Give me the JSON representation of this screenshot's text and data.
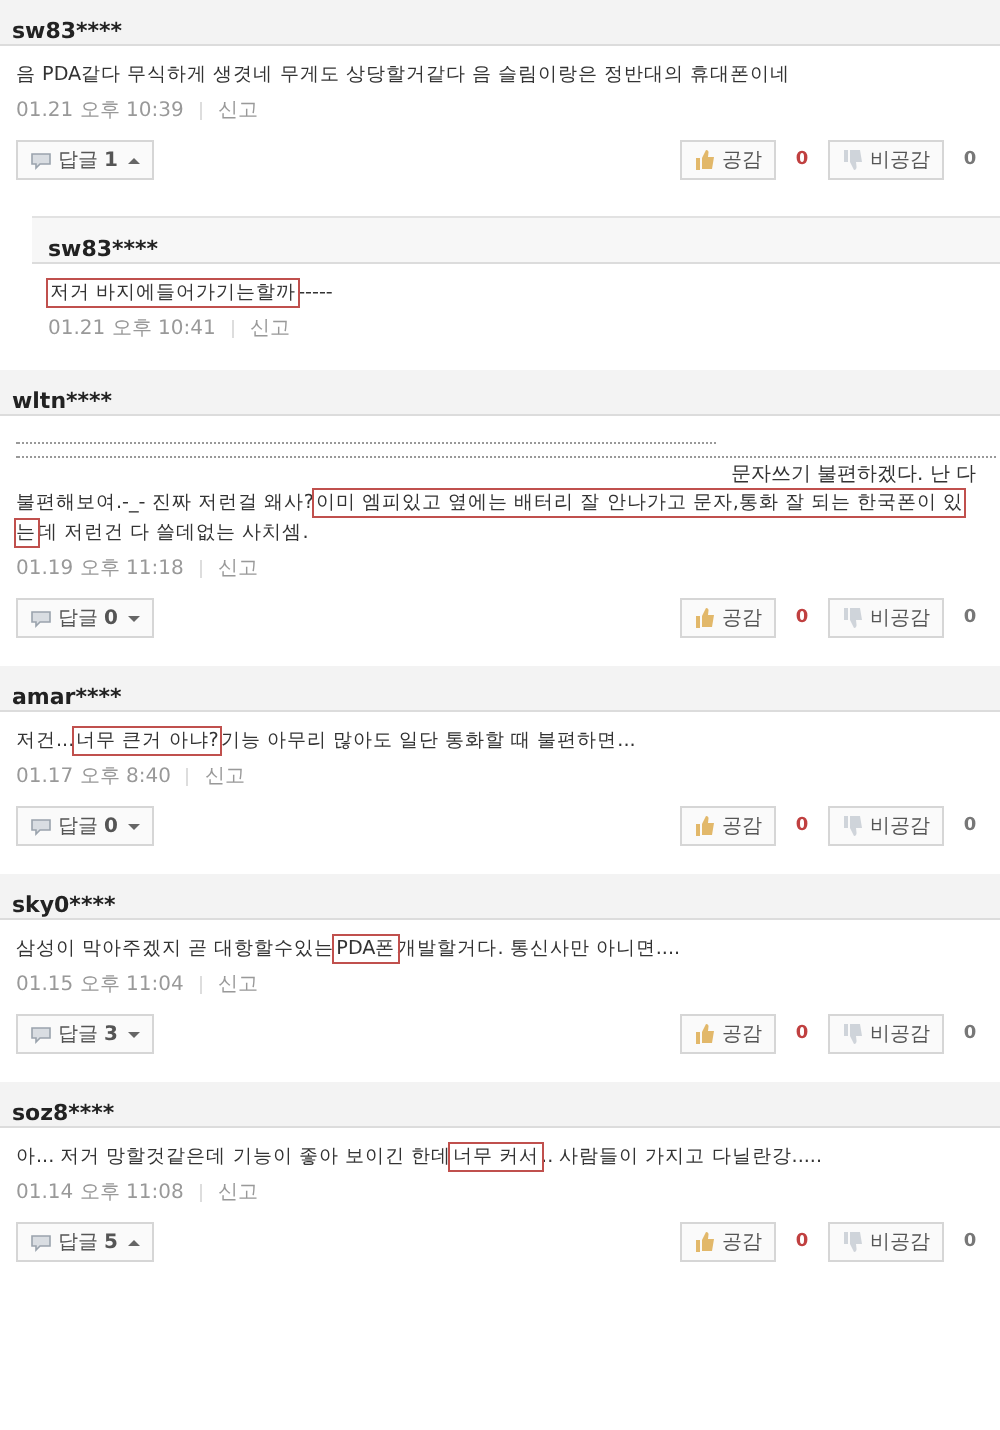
{
  "comments": [
    {
      "kind": "comment",
      "user": "sw83****",
      "segments": [
        {
          "text": "음 PDA같다 무식하게 생겻네 무게도 상당할거같다 음 슬림이랑은 정반대의 휴대폰이네",
          "highlight": false
        }
      ],
      "time": "01.21 오후 10:39",
      "report": "신고",
      "reply_label": "답글",
      "reply_count": "1",
      "expanded": true,
      "like": "공감",
      "like_count": "0",
      "dislike": "비공감",
      "dislike_count": "0"
    },
    {
      "kind": "reply",
      "user": "sw83****",
      "segments": [
        {
          "text": "저거 바지에들어가기는할까",
          "highlight": true
        },
        {
          "text": "-----",
          "highlight": false
        }
      ],
      "time": "01.21 오후 10:41",
      "report": "신고"
    },
    {
      "kind": "comment",
      "user": "wltn****",
      "quote": "문자쓰기 불편하겠다. 난 다",
      "segments": [
        {
          "text": "불편해보여.-_- 진짜 저런걸 왜사?",
          "highlight": false
        },
        {
          "text": "이미 엠피있고 옆에는 배터리 잘 안나가고 문자,통화 잘 되는 한국폰이 있는",
          "highlight": true
        },
        {
          "text": "데 저런건 다 쓸데없는 사치셈.",
          "highlight": false
        }
      ],
      "time": "01.19 오후 11:18",
      "report": "신고",
      "reply_label": "답글",
      "reply_count": "0",
      "expanded": false,
      "like": "공감",
      "like_count": "0",
      "dislike": "비공감",
      "dislike_count": "0"
    },
    {
      "kind": "comment",
      "user": "amar****",
      "segments": [
        {
          "text": "저건...",
          "highlight": false
        },
        {
          "text": "너무 큰거 아냐?",
          "highlight": true
        },
        {
          "text": "기능 아무리 많아도 일단 통화할 때 불편하면...",
          "highlight": false
        }
      ],
      "time": "01.17 오후 8:40",
      "report": "신고",
      "reply_label": "답글",
      "reply_count": "0",
      "expanded": false,
      "like": "공감",
      "like_count": "0",
      "dislike": "비공감",
      "dislike_count": "0"
    },
    {
      "kind": "comment",
      "user": "sky0****",
      "segments": [
        {
          "text": "삼성이 막아주겠지 곧 대항할수있는",
          "highlight": false
        },
        {
          "text": "PDA폰",
          "highlight": true
        },
        {
          "text": "개발할거다. 통신사만 아니면....",
          "highlight": false
        }
      ],
      "time": "01.15 오후 11:04",
      "report": "신고",
      "reply_label": "답글",
      "reply_count": "3",
      "expanded": false,
      "like": "공감",
      "like_count": "0",
      "dislike": "비공감",
      "dislike_count": "0"
    },
    {
      "kind": "comment",
      "user": "soz8****",
      "segments": [
        {
          "text": "아... 저거 망할것같은데 기능이 좋아 보이긴 한데",
          "highlight": false
        },
        {
          "text": "너무 커서",
          "highlight": true
        },
        {
          "text": ".. 사람들이 가지고 다닐란강.....",
          "highlight": false
        }
      ],
      "time": "01.14 오후 11:08",
      "report": "신고",
      "reply_label": "답글",
      "reply_count": "5",
      "expanded": true,
      "like": "공감",
      "like_count": "0",
      "dislike": "비공감",
      "dislike_count": "0"
    }
  ]
}
